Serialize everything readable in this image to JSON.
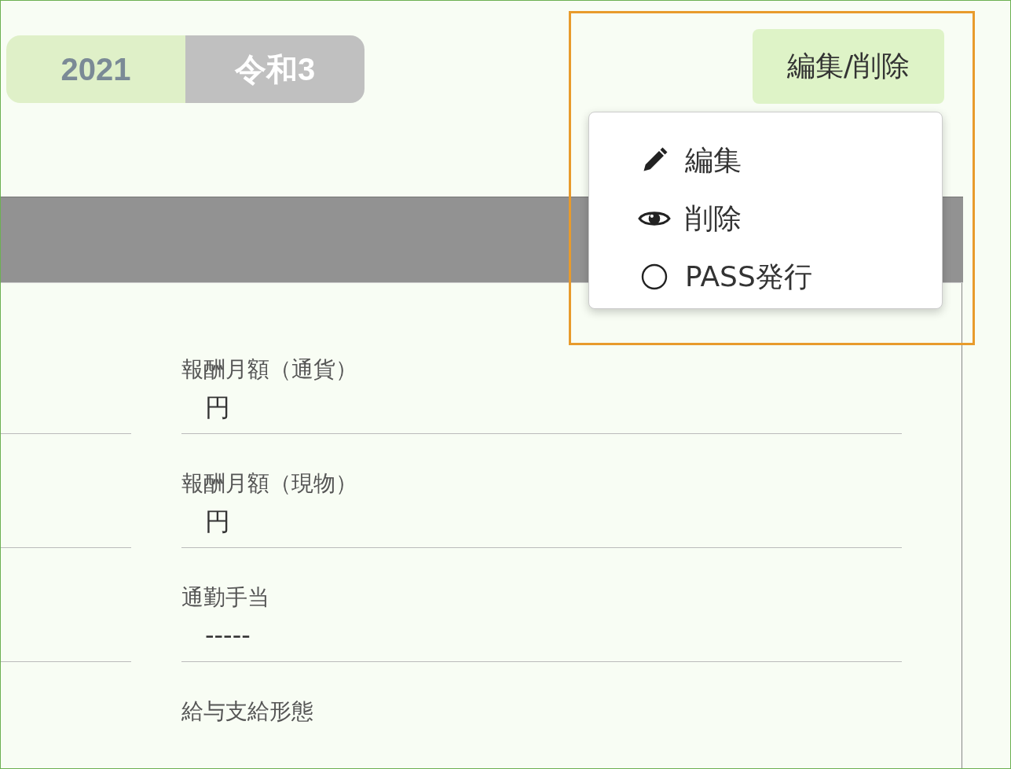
{
  "era_toggle": [
    {
      "label": "2021",
      "selected": true
    },
    {
      "label": "令和3",
      "selected": false
    }
  ],
  "edit_button": {
    "label": "編集/削除",
    "expanded": true
  },
  "menu": [
    {
      "kind": "pencil",
      "label": "編集"
    },
    {
      "kind": "eye",
      "label": "削除"
    },
    {
      "kind": "circle",
      "label": "PASS発行"
    }
  ],
  "fields": [
    {
      "label": "報酬月額（通貨）",
      "value": "円"
    },
    {
      "label": "報酬月額（現物）",
      "value": "円"
    },
    {
      "label": "通勤手当",
      "value": "-----"
    },
    {
      "label": "給与支給形態"
    }
  ],
  "highlight": true
}
